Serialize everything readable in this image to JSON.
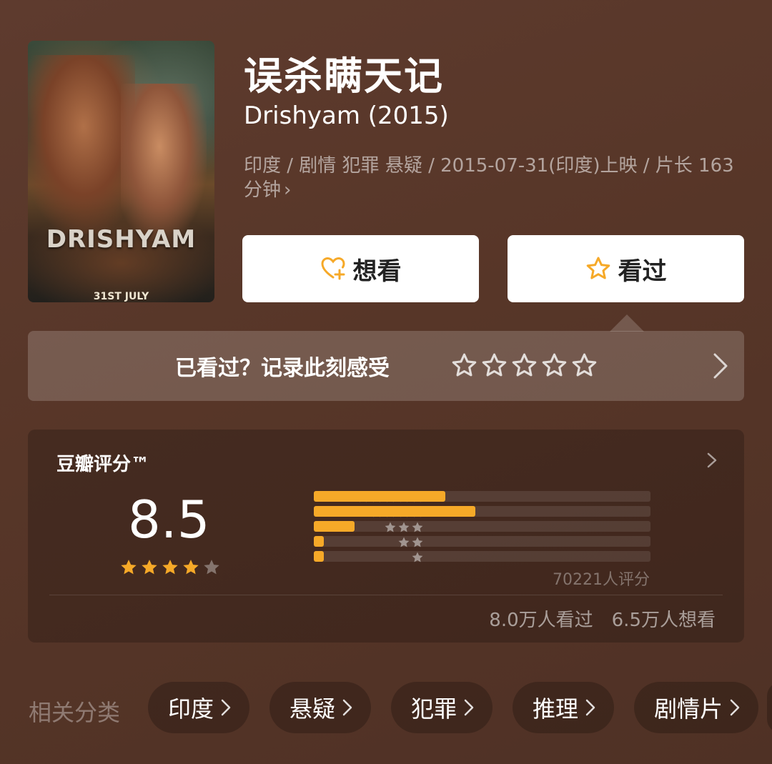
{
  "poster": {
    "title_text": "DRISHYAM",
    "date_text": "31ST JULY"
  },
  "movie": {
    "title": "误杀瞒天记",
    "subtitle": "Drishyam (2015)",
    "meta": "印度 / 剧情 犯罪 悬疑 / 2015-07-31(印度)上映 / 片长 163分钟",
    "meta_chevron": "›"
  },
  "actions": {
    "want_label": "想看",
    "seen_label": "看过"
  },
  "rate_prompt": {
    "text": "已看过？记录此刻感受",
    "star_count": 5
  },
  "rating": {
    "label": "豆瓣评分™",
    "score": "8.5",
    "stars_filled": 4,
    "stars_total": 5,
    "distribution": [
      {
        "stars": 5,
        "fraction": 0.39
      },
      {
        "stars": 4,
        "fraction": 0.48
      },
      {
        "stars": 3,
        "fraction": 0.12
      },
      {
        "stars": 2,
        "fraction": 0.03
      },
      {
        "stars": 1,
        "fraction": 0.03
      }
    ],
    "votes": "70221人评分",
    "seen_count": "8.0万人看过",
    "want_count": "6.5万人想看"
  },
  "related": {
    "label": "相关分类",
    "tags": [
      "印度",
      "悬疑",
      "犯罪",
      "推理",
      "剧情片"
    ]
  },
  "colors": {
    "accent": "#f6a928",
    "background": "#5a3829"
  }
}
